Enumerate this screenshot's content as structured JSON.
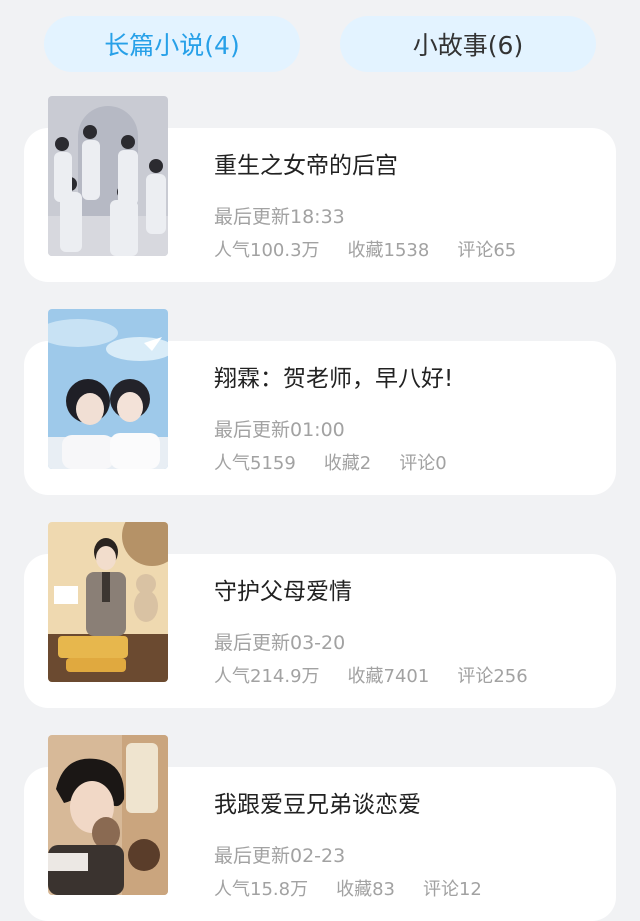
{
  "tabs": [
    {
      "label": "长篇小说(4)",
      "active": true
    },
    {
      "label": "小故事(6)",
      "active": false
    }
  ],
  "colors": {
    "accent": "#27a0e8",
    "tab_bg": "#e3f3ff",
    "page_bg": "#f1f2f4"
  },
  "books": [
    {
      "title": "重生之女帝的后宫",
      "updated": "最后更新18:33",
      "popularity": "人气100.3万",
      "favorites": "收藏1538",
      "comments": "评论65",
      "cover_icon": "group-photo-cover"
    },
    {
      "title": "翔霖：贺老师，早八好!",
      "updated": "最后更新01:00",
      "popularity": "人气5159",
      "favorites": "收藏2",
      "comments": "评论0",
      "cover_icon": "two-boys-sky-cover"
    },
    {
      "title": "守护父母爱情",
      "updated": "最后更新03-20",
      "popularity": "人气214.9万",
      "favorites": "收藏7401",
      "comments": "评论256",
      "cover_icon": "boy-with-bear-cover"
    },
    {
      "title": "我跟爱豆兄弟谈恋爱",
      "updated": "最后更新02-23",
      "popularity": "人气15.8万",
      "favorites": "收藏83",
      "comments": "评论12",
      "cover_icon": "boy-portrait-cover"
    }
  ]
}
